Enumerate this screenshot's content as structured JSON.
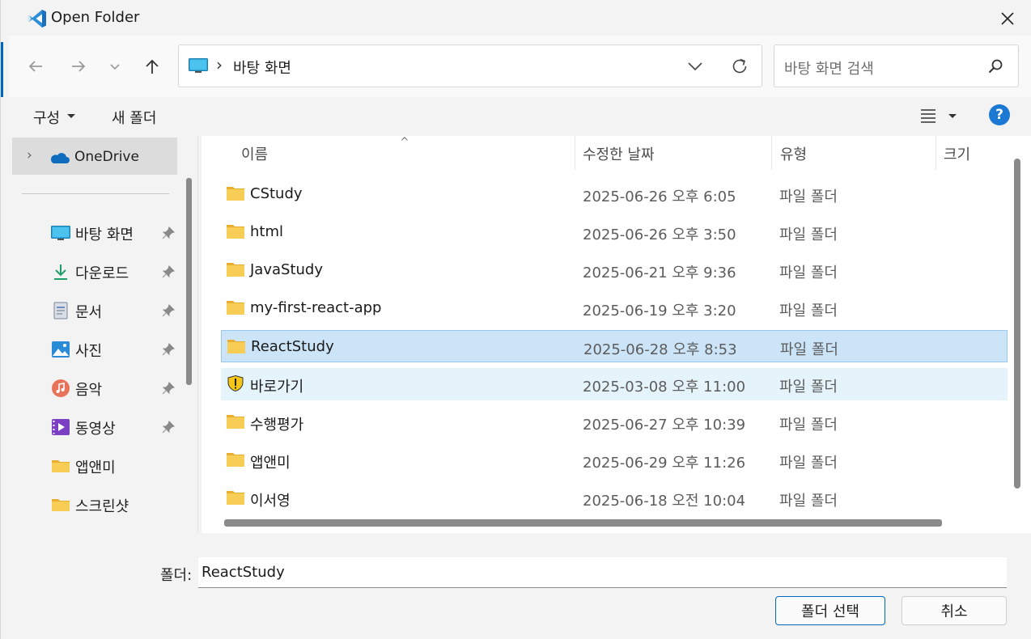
{
  "window": {
    "title": "Open Folder"
  },
  "address": {
    "location": "바탕 화면",
    "separator": "›"
  },
  "search": {
    "placeholder": "바탕 화면 검색"
  },
  "toolbar": {
    "organize_label": "구성",
    "new_folder_label": "새 폴더",
    "help_label": "?"
  },
  "navpane": {
    "onedrive_label": "OneDrive",
    "items": [
      {
        "label": "바탕 화면",
        "icon": "desktop-icon",
        "pinned": true
      },
      {
        "label": "다운로드",
        "icon": "download-icon",
        "pinned": true
      },
      {
        "label": "문서",
        "icon": "documents-icon",
        "pinned": true
      },
      {
        "label": "사진",
        "icon": "pictures-icon",
        "pinned": true
      },
      {
        "label": "음악",
        "icon": "music-icon",
        "pinned": true
      },
      {
        "label": "동영상",
        "icon": "videos-icon",
        "pinned": true
      },
      {
        "label": "앱앤미",
        "icon": "folder-icon",
        "pinned": false
      },
      {
        "label": "스크린샷",
        "icon": "folder-icon",
        "pinned": false
      }
    ]
  },
  "columns": {
    "name": "이름",
    "date": "수정한 날짜",
    "type": "유형",
    "size": "크기"
  },
  "files": [
    {
      "name": "CStudy",
      "date": "2025-06-26 오후 6:05",
      "type": "파일 폴더",
      "icon": "folder-icon",
      "state": ""
    },
    {
      "name": "html",
      "date": "2025-06-26 오후 3:50",
      "type": "파일 폴더",
      "icon": "folder-icon",
      "state": ""
    },
    {
      "name": "JavaStudy",
      "date": "2025-06-21 오후 9:36",
      "type": "파일 폴더",
      "icon": "folder-icon",
      "state": ""
    },
    {
      "name": "my-first-react-app",
      "date": "2025-06-19 오후 3:20",
      "type": "파일 폴더",
      "icon": "folder-icon",
      "state": ""
    },
    {
      "name": "ReactStudy",
      "date": "2025-06-28 오후 8:53",
      "type": "파일 폴더",
      "icon": "folder-icon",
      "state": "selected"
    },
    {
      "name": "바로가기",
      "date": "2025-03-08 오후 11:00",
      "type": "파일 폴더",
      "icon": "shield-warning-icon",
      "state": "hover"
    },
    {
      "name": "수행평가",
      "date": "2025-06-27 오후 10:39",
      "type": "파일 폴더",
      "icon": "folder-icon",
      "state": ""
    },
    {
      "name": "앱앤미",
      "date": "2025-06-29 오후 11:26",
      "type": "파일 폴더",
      "icon": "folder-icon",
      "state": ""
    },
    {
      "name": "이서영",
      "date": "2025-06-18 오전 10:04",
      "type": "파일 폴더",
      "icon": "folder-icon",
      "state": ""
    }
  ],
  "footer": {
    "folder_label": "폴더:",
    "folder_value": "ReactStudy",
    "select_button": "폴더 선택",
    "cancel_button": "취소"
  },
  "colors": {
    "accent": "#0067c0",
    "selected_row": "#cce4f7",
    "hover_row": "#e5f3fb",
    "folder": "#f7c948"
  }
}
